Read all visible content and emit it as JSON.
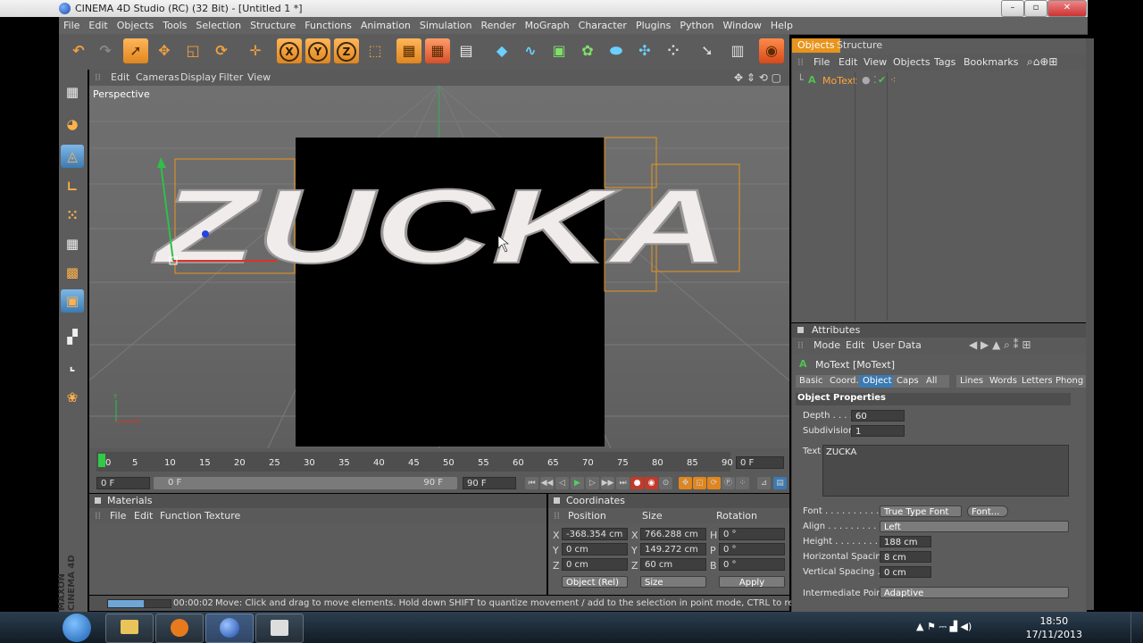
{
  "window": {
    "title": "CINEMA 4D Studio (RC) (32 Bit) - [Untitled 1 *]"
  },
  "menu": [
    "File",
    "Edit",
    "Objects",
    "Tools",
    "Selection",
    "Structure",
    "Functions",
    "Animation",
    "Simulation",
    "Render",
    "MoGraph",
    "Character",
    "Plugins",
    "Python",
    "Window",
    "Help"
  ],
  "toolbar_icons": [
    "undo-icon",
    "redo-icon",
    "live-selection-icon",
    "move-icon",
    "scale-icon",
    "rotate-icon",
    "move-tool-icon",
    "x-axis-icon",
    "y-axis-icon",
    "z-axis-icon",
    "coordinate-system-icon",
    "render-view-icon",
    "render-picture-queue-icon",
    "render-settings-icon",
    "cube-icon",
    "spline-icon",
    "nurbs-icon",
    "array-icon",
    "deformer-icon",
    "scene-icon",
    "particle-icon",
    "light-icon",
    "camera-icon",
    "floor-icon"
  ],
  "viewport": {
    "menu": [
      "Edit",
      "Cameras",
      "Display",
      "Filter",
      "View"
    ],
    "label": "Perspective",
    "text3d": "ZUCKA"
  },
  "timeline": {
    "ticks": [
      "0",
      "5",
      "10",
      "15",
      "20",
      "25",
      "30",
      "35",
      "40",
      "45",
      "50",
      "55",
      "60",
      "65",
      "70",
      "75",
      "80",
      "85",
      "90"
    ],
    "current_frame": "0 F",
    "start_frame": "0 F",
    "range_start": "0 F",
    "range_end": "90 F",
    "end_frame": "90 F"
  },
  "materials": {
    "title": "Materials",
    "menu": [
      "File",
      "Edit",
      "Function",
      "Texture"
    ]
  },
  "coordinates": {
    "title": "Coordinates",
    "headers": [
      "Position",
      "Size",
      "Rotation"
    ],
    "rows": [
      {
        "axis": "X",
        "pos": "-368.354 cm",
        "size_axis": "X",
        "size": "766.288 cm",
        "rot_axis": "H",
        "rot": "0 °"
      },
      {
        "axis": "Y",
        "pos": "0 cm",
        "size_axis": "Y",
        "size": "149.272 cm",
        "rot_axis": "P",
        "rot": "0 °"
      },
      {
        "axis": "Z",
        "pos": "0 cm",
        "size_axis": "Z",
        "size": "60 cm",
        "rot_axis": "B",
        "rot": "0 °"
      }
    ],
    "mode": "Object (Rel)",
    "size_mode": "Size",
    "apply": "Apply"
  },
  "objects_panel": {
    "tabs": [
      "Objects",
      "Structure"
    ],
    "menu": [
      "File",
      "Edit",
      "View",
      "Objects",
      "Tags",
      "Bookmarks"
    ],
    "items": [
      {
        "name": "MoText"
      }
    ]
  },
  "attributes": {
    "title": "Attributes",
    "menu": [
      "Mode",
      "Edit",
      "User Data"
    ],
    "object_label": "MoText [MoText]",
    "tabs": [
      "Basic",
      "Coord.",
      "Object",
      "Caps",
      "All",
      "Lines",
      "Words",
      "Letters",
      "Phong"
    ],
    "active_tab": "Object",
    "section": "Object Properties",
    "depth_label": "Depth . . . .",
    "depth": "60",
    "subdivision_label": "Subdivision",
    "subdivision": "1",
    "text_label": "Text",
    "text": "ZUCKA",
    "font_label": "Font . . . . . . . . . .",
    "font_type": "True Type Font",
    "font_button": "Font...",
    "align_label": "Align . . . . . . . . .",
    "align": "Left",
    "height_label": "Height . . . . . . . .",
    "height": "188 cm",
    "hspacing_label": "Horizontal Spacing",
    "hspacing": "8 cm",
    "vspacing_label": "Vertical Spacing . .",
    "vspacing": "0 cm",
    "interp_label": "Intermediate Points",
    "interp": "Adaptive"
  },
  "status": {
    "time": "00:00:02",
    "message": "Move: Click and drag to move elements. Hold down SHIFT to quantize movement / add to the selection in point mode, CTRL to remove."
  },
  "maxon": "MAXON CINEMA 4D",
  "taskbar": {
    "time": "18:50",
    "date": "17/11/2013"
  }
}
